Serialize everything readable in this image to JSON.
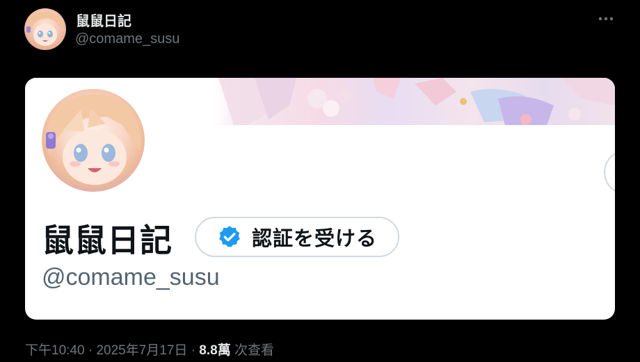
{
  "post_header": {
    "display_name": "鼠鼠日記",
    "handle": "@comame_susu",
    "more_label": "···"
  },
  "profile_card": {
    "display_name": "鼠鼠日記",
    "verify_button_label": "認証を受ける",
    "handle": "@comame_susu"
  },
  "meta": {
    "time": "下午10:40",
    "separator": "·",
    "date": "2025年7月17日",
    "views_count": "8.8萬",
    "views_label": "次查看"
  },
  "colors": {
    "background": "#000000",
    "card_background": "#ffffff",
    "verified_blue": "#1d9bf0",
    "secondary_text": "#71767b"
  },
  "icons": {
    "more": "more-horizontal-icon",
    "verified": "verified-badge-icon"
  }
}
